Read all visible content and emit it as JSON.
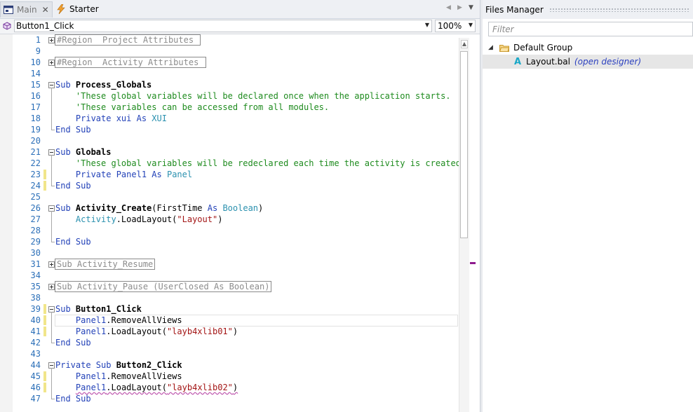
{
  "tabs": [
    {
      "label": "Main",
      "close": "✕",
      "active": false
    },
    {
      "label": "Starter",
      "active": true
    }
  ],
  "toolbar": {
    "sub_selected": "Button1_Click",
    "zoom": "100%"
  },
  "code": [
    {
      "n": "1",
      "kind": "collapsed",
      "parts": [
        {
          "c": "collapsed",
          "t": "#Region  Project Attributes "
        }
      ]
    },
    {
      "n": "9",
      "kind": "blank",
      "parts": []
    },
    {
      "n": "10",
      "kind": "collapsed",
      "parts": [
        {
          "c": "collapsed",
          "t": "#Region  Activity Attributes "
        }
      ]
    },
    {
      "n": "14",
      "kind": "blank",
      "parts": []
    },
    {
      "n": "15",
      "kind": "start",
      "parts": [
        {
          "c": "kw",
          "t": "Sub "
        },
        {
          "c": "bd",
          "t": "Process_Globals"
        }
      ]
    },
    {
      "n": "16",
      "kind": "body",
      "parts": [
        {
          "c": "cm",
          "t": "    'These global variables will be declared once when the application starts."
        }
      ]
    },
    {
      "n": "17",
      "kind": "body",
      "parts": [
        {
          "c": "cm",
          "t": "    'These variables can be accessed from all modules."
        }
      ]
    },
    {
      "n": "18",
      "kind": "body",
      "parts": [
        {
          "c": "kw",
          "t": "    Private "
        },
        {
          "c": "kw",
          "t": "xui"
        },
        {
          "c": "kw",
          "t": " As "
        },
        {
          "c": "ty",
          "t": "XUI"
        }
      ]
    },
    {
      "n": "19",
      "kind": "end",
      "parts": [
        {
          "c": "kw",
          "t": "End Sub"
        }
      ]
    },
    {
      "n": "20",
      "kind": "blank",
      "parts": []
    },
    {
      "n": "21",
      "kind": "start",
      "parts": [
        {
          "c": "kw",
          "t": "Sub "
        },
        {
          "c": "bd",
          "t": "Globals"
        }
      ]
    },
    {
      "n": "22",
      "kind": "body",
      "parts": [
        {
          "c": "cm",
          "t": "    'These global variables will be redeclared each time the activity is created."
        }
      ]
    },
    {
      "n": "23",
      "kind": "body",
      "mark": true,
      "parts": [
        {
          "c": "kw",
          "t": "    Private "
        },
        {
          "c": "kw",
          "t": "Panel1"
        },
        {
          "c": "kw",
          "t": " As "
        },
        {
          "c": "ty",
          "t": "Panel"
        }
      ]
    },
    {
      "n": "24",
      "kind": "end",
      "mark": true,
      "parts": [
        {
          "c": "kw",
          "t": "End Sub"
        }
      ]
    },
    {
      "n": "25",
      "kind": "blank",
      "parts": []
    },
    {
      "n": "26",
      "kind": "start",
      "parts": [
        {
          "c": "kw",
          "t": "Sub "
        },
        {
          "c": "bd",
          "t": "Activity_Create"
        },
        {
          "c": "",
          "t": "(FirstTime "
        },
        {
          "c": "kw",
          "t": "As "
        },
        {
          "c": "ty",
          "t": "Boolean"
        },
        {
          "c": "",
          "t": ")"
        }
      ]
    },
    {
      "n": "27",
      "kind": "body",
      "parts": [
        {
          "c": "ty",
          "t": "    Activity"
        },
        {
          "c": "",
          "t": ".LoadLayout("
        },
        {
          "c": "st",
          "t": "\"Layout\""
        },
        {
          "c": "",
          "t": ")"
        }
      ]
    },
    {
      "n": "28",
      "kind": "body",
      "parts": []
    },
    {
      "n": "29",
      "kind": "end",
      "parts": [
        {
          "c": "kw",
          "t": "End Sub"
        }
      ]
    },
    {
      "n": "30",
      "kind": "blank",
      "parts": []
    },
    {
      "n": "31",
      "kind": "collapsed",
      "parts": [
        {
          "c": "collapsed",
          "t": "Sub Activity_Resume"
        }
      ]
    },
    {
      "n": "34",
      "kind": "blank",
      "parts": []
    },
    {
      "n": "35",
      "kind": "collapsed",
      "parts": [
        {
          "c": "collapsed",
          "t": "Sub Activity_Pause (UserClosed As Boolean)"
        }
      ]
    },
    {
      "n": "38",
      "kind": "blank",
      "parts": []
    },
    {
      "n": "39",
      "kind": "start",
      "mark": true,
      "parts": [
        {
          "c": "kw",
          "t": "Sub "
        },
        {
          "c": "bd",
          "t": "Button1_Click"
        }
      ]
    },
    {
      "n": "40",
      "kind": "body",
      "mark": true,
      "parts": [
        {
          "c": "kw",
          "t": "    Panel1"
        },
        {
          "c": "",
          "t": ".RemoveAllViews"
        }
      ]
    },
    {
      "n": "41",
      "kind": "body",
      "mark": true,
      "parts": [
        {
          "c": "kw",
          "t": "    Panel1"
        },
        {
          "c": "",
          "t": ".LoadLayout("
        },
        {
          "c": "st",
          "t": "\"layb4xlib01\""
        },
        {
          "c": "",
          "t": ")"
        }
      ]
    },
    {
      "n": "42",
      "kind": "end",
      "parts": [
        {
          "c": "kw",
          "t": "End Sub"
        }
      ]
    },
    {
      "n": "43",
      "kind": "blank",
      "parts": []
    },
    {
      "n": "44",
      "kind": "start",
      "parts": [
        {
          "c": "kw",
          "t": "Private Sub "
        },
        {
          "c": "bd",
          "t": "Button2_Click"
        }
      ]
    },
    {
      "n": "45",
      "kind": "body",
      "mark": true,
      "parts": [
        {
          "c": "kw",
          "t": "    Panel1"
        },
        {
          "c": "",
          "t": ".RemoveAllViews"
        }
      ]
    },
    {
      "n": "46",
      "kind": "body",
      "mark": true,
      "parts": [
        {
          "c": "",
          "t": "    "
        },
        {
          "c": "kw squiggle",
          "t": "Panel1"
        },
        {
          "c": "squiggle",
          "t": ".LoadLayout("
        },
        {
          "c": "st squiggle",
          "t": "\"layb4xlib02\""
        },
        {
          "c": "squiggle",
          "t": ")"
        }
      ]
    },
    {
      "n": "47",
      "kind": "end",
      "parts": [
        {
          "c": "kw",
          "t": "End Sub"
        }
      ]
    }
  ],
  "files_panel": {
    "title": "Files Manager",
    "filter_placeholder": "Filter",
    "group": "Default Group",
    "file_name": "Layout.bal",
    "file_action": "(open designer)"
  },
  "colors": {
    "accent_purple": "#8e1b8e",
    "line_number": "#2b6fb8",
    "keyword": "#2342b8",
    "comment": "#1e8b1e",
    "string": "#a31515",
    "type": "#2b91af"
  },
  "icons": {
    "main_tab": "form-designer-icon",
    "starter_tab": "lightning-icon",
    "sub_list": "cube-icon",
    "file": "letter-a-icon",
    "group": "folder-icon"
  }
}
